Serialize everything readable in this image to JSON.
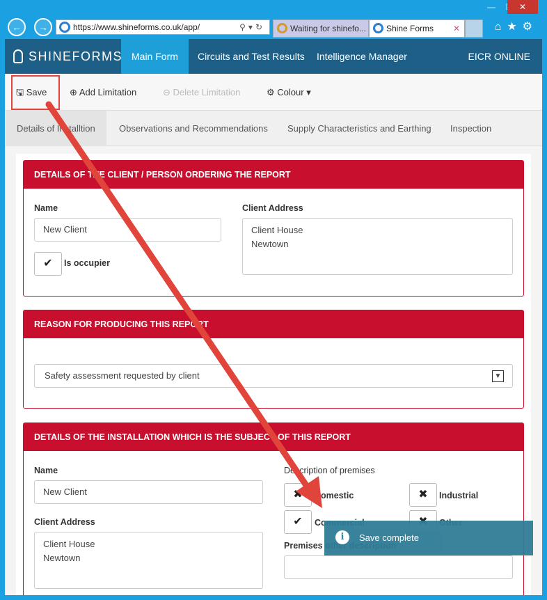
{
  "browser": {
    "url": "https://www.shineforms.co.uk/app/",
    "tabs": [
      {
        "label": "Waiting for shinefo..."
      },
      {
        "label": "Shine Forms"
      }
    ]
  },
  "app": {
    "brand": "SHINEFORMS",
    "nav": [
      {
        "label": "Main Form"
      },
      {
        "label": "Circuits and Test Results"
      },
      {
        "label": "Intelligence Manager"
      }
    ],
    "nav_right": "EICR ONLINE"
  },
  "toolbar": {
    "save": "Save",
    "add_limitation": "Add Limitation",
    "delete_limitation": "Delete Limitation",
    "colour": "Colour"
  },
  "section_tabs": [
    {
      "label": "Details of Installtion"
    },
    {
      "label": "Observations and Recommendations"
    },
    {
      "label": "Supply Characteristics and Earthing"
    },
    {
      "label": "Inspection Schedule"
    }
  ],
  "client_panel": {
    "title": "DETAILS OF THE CLIENT / PERSON ORDERING THE REPORT",
    "name_label": "Name",
    "name_value": "New Client",
    "address_label": "Client Address",
    "address_line1": "Client House",
    "address_line2": "Newtown",
    "occupier_label": "Is occupier"
  },
  "reason_panel": {
    "title": "REASON FOR PRODUCING THIS REPORT",
    "selected": "Safety assessment requested by client"
  },
  "install_panel": {
    "title": "DETAILS OF THE INSTALLATION WHICH IS THE SUBJECT OF THIS REPORT",
    "name_label": "Name",
    "name_value": "New Client",
    "address_label": "Client Address",
    "address_line1": "Client House",
    "address_line2": "Newtown",
    "premises_label": "Description of premises",
    "premises": {
      "domestic": "Domestic",
      "industrial": "Industrial",
      "commercial": "Commercial",
      "other": "Other"
    },
    "other_desc_label": "Premises other description"
  },
  "toast": {
    "message": "Save complete"
  },
  "colors": {
    "navbar": "#1d5f86",
    "nav_active": "#1e9fd8",
    "panel_red": "#c8102e",
    "highlight": "#e0443a",
    "toast": "#2f7c96"
  }
}
